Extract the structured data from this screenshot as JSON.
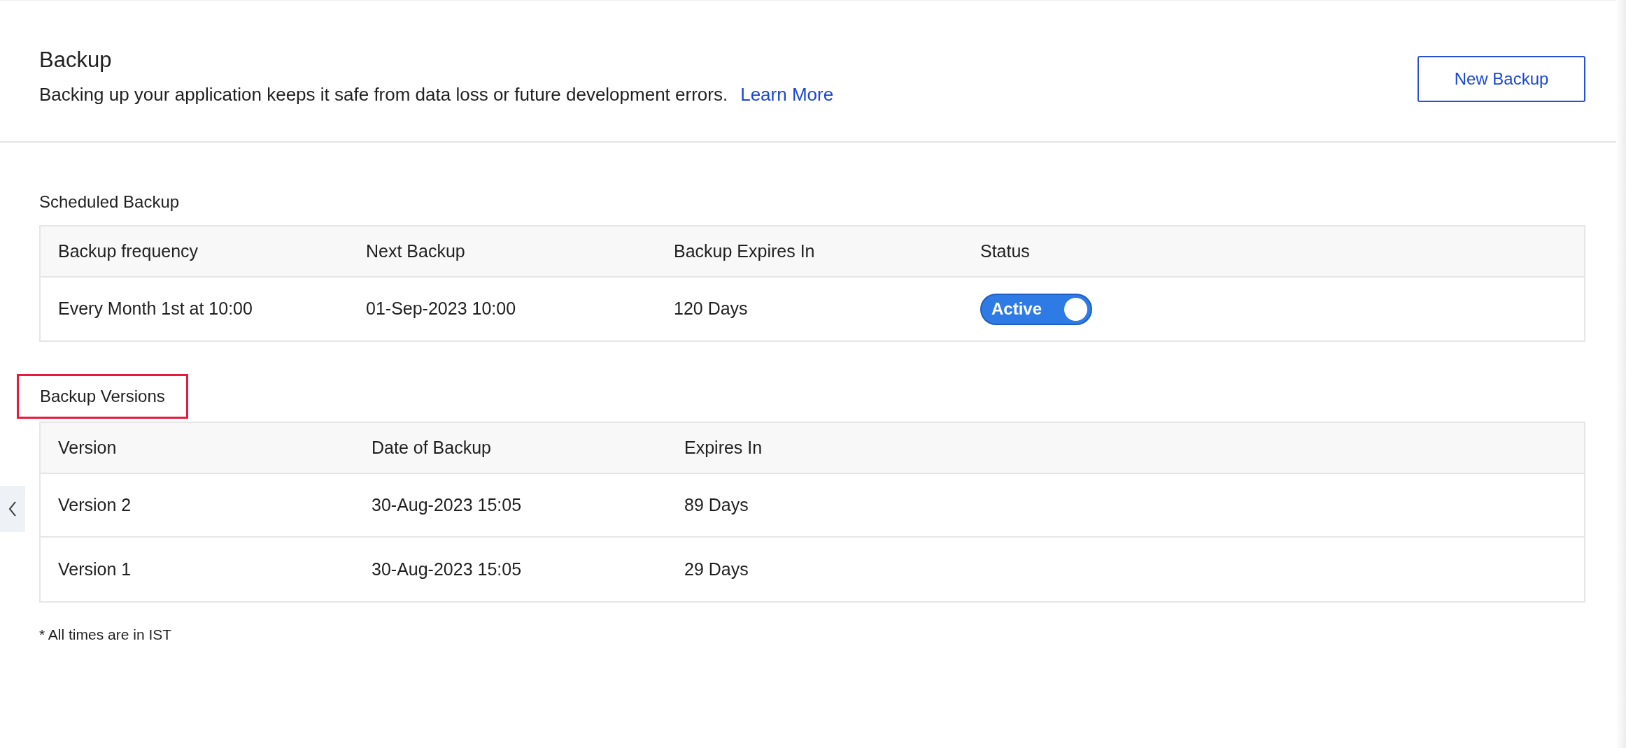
{
  "header": {
    "title": "Backup",
    "description": "Backing up your application keeps it safe from data loss or future development errors.",
    "link": "Learn More",
    "button": "New Backup"
  },
  "scheduled": {
    "heading": "Scheduled Backup",
    "columns": [
      "Backup frequency",
      "Next Backup",
      "Backup Expires In",
      "Status"
    ],
    "rows": [
      {
        "frequency": "Every Month 1st at 10:00",
        "next": "01-Sep-2023 10:00",
        "expires": "120 Days",
        "status": {
          "label": "Active",
          "on": true
        }
      }
    ]
  },
  "versions": {
    "heading": "Backup Versions",
    "highlighted": true,
    "columns": [
      "Version",
      "Date of Backup",
      "Expires In"
    ],
    "rows": [
      {
        "version": "Version 2",
        "date": "30-Aug-2023 15:05",
        "expires": "89 Days"
      },
      {
        "version": "Version 1",
        "date": "30-Aug-2023 15:05",
        "expires": "29 Days"
      }
    ]
  },
  "footnote": "* All times are in IST"
}
